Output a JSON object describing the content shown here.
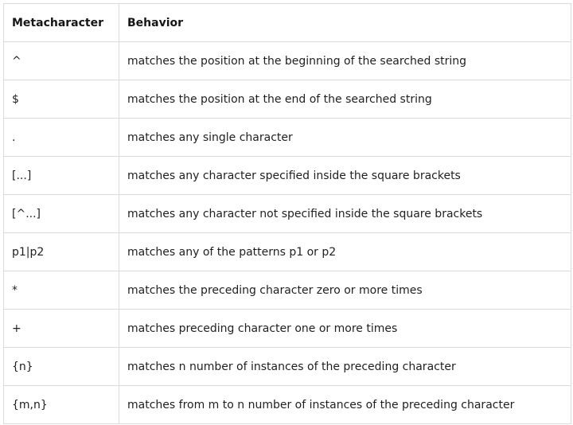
{
  "table": {
    "headers": [
      "Metacharacter",
      "Behavior"
    ],
    "rows": [
      [
        "^",
        "matches the position at the beginning of the searched string"
      ],
      [
        "$",
        "matches the position at the end of the searched string"
      ],
      [
        ".",
        "matches any single character"
      ],
      [
        "[...]",
        "matches any character specified inside the square brackets"
      ],
      [
        "[^...]",
        "matches any character not specified inside the square brackets"
      ],
      [
        "p1|p2",
        "matches any of the patterns p1 or p2"
      ],
      [
        "*",
        "matches the preceding character zero or more times"
      ],
      [
        "+",
        "matches preceding character one or more times"
      ],
      [
        "{n}",
        "matches n number of instances of the preceding character"
      ],
      [
        "{m,n}",
        "matches from m to n number of instances of the preceding character"
      ]
    ]
  }
}
